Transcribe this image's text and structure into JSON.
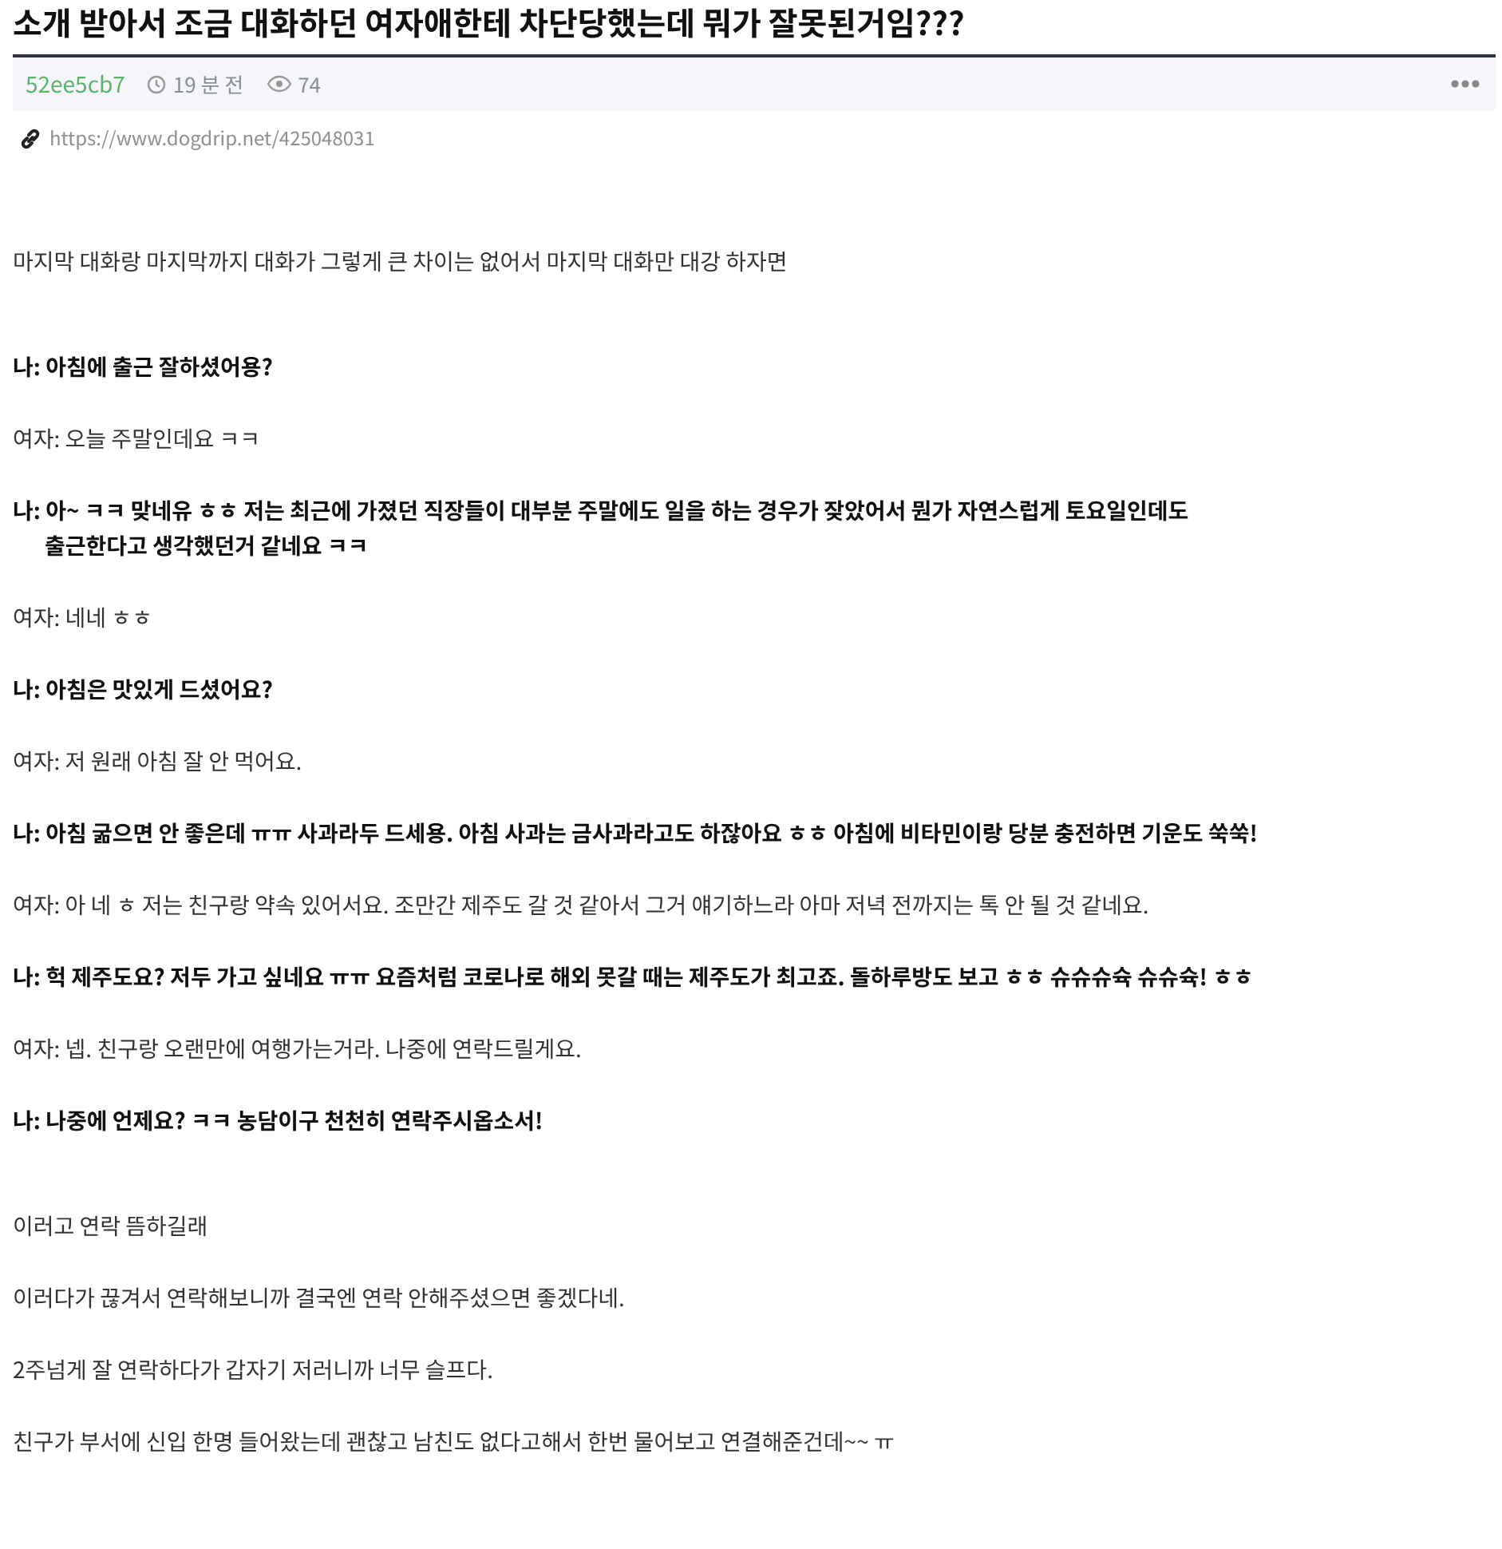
{
  "post": {
    "title": "소개 받아서 조금 대화하던 여자애한테 차단당했는데 뭐가 잘못된거임???",
    "author": "52ee5cb7",
    "time": "19 분 전",
    "views": "74",
    "url": "https://www.dogdrip.net/425048031"
  },
  "sections": [
    {
      "paragraphs": [
        {
          "kind": "plain",
          "lines": [
            "마지막 대화랑 마지막까지 대화가 그렇게 큰 차이는 없어서 마지막 대화만 대강 하자면"
          ]
        }
      ]
    },
    {
      "paragraphs": [
        {
          "kind": "me",
          "lines": [
            "나: 아침에 출근 잘하셨어용?"
          ]
        },
        {
          "kind": "her",
          "lines": [
            "여자: 오늘 주말인데요 ㅋㅋ"
          ]
        },
        {
          "kind": "me",
          "lines": [
            "나: 아~ ㅋㅋ 맞네유 ㅎㅎ 저는 최근에 가졌던 직장들이 대부분 주말에도 일을 하는 경우가 잦았어서 뭔가 자연스럽게 토요일인데도",
            "출근한다고 생각했던거 같네요 ㅋㅋ"
          ]
        },
        {
          "kind": "her",
          "lines": [
            "여자: 네네 ㅎㅎ"
          ]
        },
        {
          "kind": "me",
          "lines": [
            "나: 아침은 맛있게 드셨어요?"
          ]
        },
        {
          "kind": "her",
          "lines": [
            "여자: 저 원래 아침 잘 안 먹어요."
          ]
        },
        {
          "kind": "me",
          "lines": [
            "나: 아침 굶으면 안 좋은데 ㅠㅠ 사과라두 드세용. 아침 사과는 금사과라고도 하잖아요 ㅎㅎ 아침에 비타민이랑 당분 충전하면 기운도 쑥쑥!"
          ]
        },
        {
          "kind": "her",
          "lines": [
            "여자: 아 네 ㅎ 저는 친구랑 약속 있어서요. 조만간 제주도 갈 것 같아서 그거 얘기하느라 아마 저녁 전까지는 톡 안 될 것 같네요."
          ]
        },
        {
          "kind": "me",
          "lines": [
            "나: 헉 제주도요? 저두 가고 싶네요 ㅠㅠ 요즘처럼 코로나로 해외 못갈 때는 제주도가 최고죠. 돌하루방도 보고 ㅎㅎ 슈슈슈슉 슈슈슉! ㅎㅎ"
          ]
        },
        {
          "kind": "her",
          "lines": [
            "여자: 넵. 친구랑 오랜만에 여행가는거라. 나중에 연락드릴게요."
          ]
        },
        {
          "kind": "me",
          "lines": [
            "나: 나중에 언제요? ㅋㅋ 농담이구 천천히 연락주시옵소서!"
          ]
        }
      ]
    },
    {
      "paragraphs": [
        {
          "kind": "plain",
          "lines": [
            "이러고 연락 뜸하길래"
          ]
        },
        {
          "kind": "plain",
          "lines": [
            "이러다가 끊겨서 연락해보니까 결국엔 연락 안해주셨으면 좋겠다네."
          ]
        },
        {
          "kind": "plain",
          "lines": [
            "2주넘게 잘 연락하다가 갑자기 저러니까 너무 슬프다."
          ]
        },
        {
          "kind": "plain",
          "lines": [
            "친구가 부서에 신입 한명 들어왔는데 괜찮고 남친도 없다고해서 한번 물어보고 연결해준건데~~ ㅠ"
          ]
        }
      ]
    }
  ]
}
